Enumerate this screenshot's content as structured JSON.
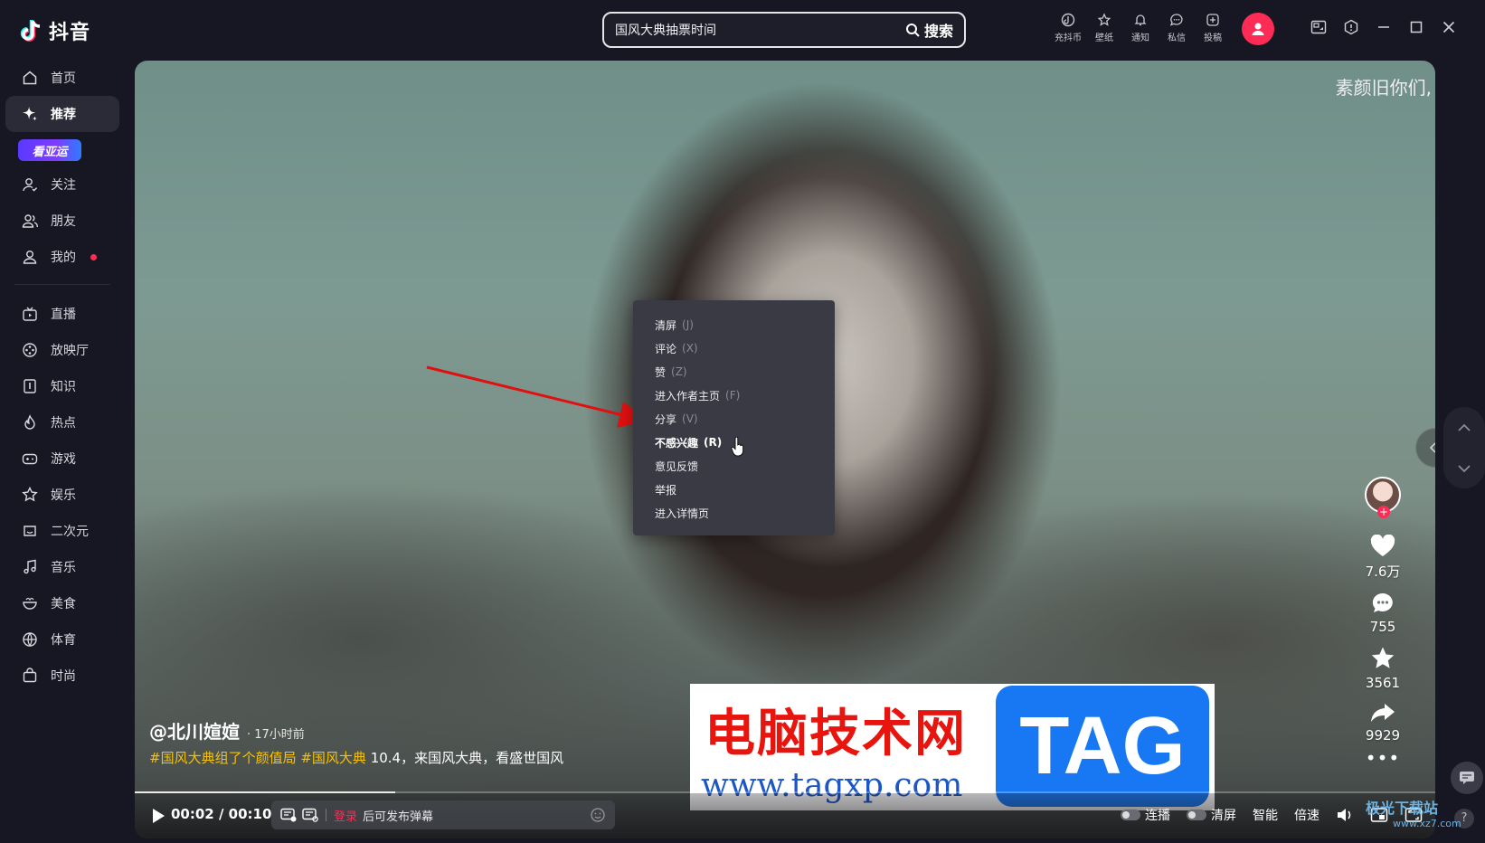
{
  "app": {
    "name": "抖音"
  },
  "search": {
    "query": "国风大典抽票时间",
    "button_label": "搜索"
  },
  "top_actions": [
    {
      "label": "充抖币",
      "icon": "coin-icon"
    },
    {
      "label": "壁纸",
      "icon": "wallpaper-icon"
    },
    {
      "label": "通知",
      "icon": "bell-icon"
    },
    {
      "label": "私信",
      "icon": "message-icon"
    },
    {
      "label": "投稿",
      "icon": "upload-icon"
    }
  ],
  "sidebar": {
    "items": [
      {
        "label": "首页",
        "icon": "home-icon"
      },
      {
        "label": "推荐",
        "icon": "sparkle-icon",
        "active": true
      },
      {
        "label": "关注",
        "icon": "follow-icon"
      },
      {
        "label": "朋友",
        "icon": "friends-icon"
      },
      {
        "label": "我的",
        "icon": "user-icon",
        "badge": true
      }
    ],
    "promo_label": "看亚运",
    "categories": [
      {
        "label": "直播",
        "icon": "tv-icon"
      },
      {
        "label": "放映厅",
        "icon": "film-icon"
      },
      {
        "label": "知识",
        "icon": "book-icon"
      },
      {
        "label": "热点",
        "icon": "flame-icon"
      },
      {
        "label": "游戏",
        "icon": "gamepad-icon"
      },
      {
        "label": "娱乐",
        "icon": "star-icon"
      },
      {
        "label": "二次元",
        "icon": "anime-icon"
      },
      {
        "label": "音乐",
        "icon": "music-icon"
      },
      {
        "label": "美食",
        "icon": "food-icon"
      },
      {
        "label": "体育",
        "icon": "ball-icon"
      },
      {
        "label": "时尚",
        "icon": "bag-icon"
      }
    ]
  },
  "video": {
    "overlay_text": "素颜旧你们,",
    "author": "@北川媗媗",
    "post_time": "· 17小时前",
    "tags": [
      "#国风大典组了个颜值局",
      "#国风大典"
    ],
    "description": " 10.4，来国风大典，看盛世国风",
    "likes": "7.6万",
    "comments": "755",
    "favorites": "3561",
    "shares": "9929",
    "progress": 0.2,
    "time": "00:02 / 00:10"
  },
  "context_menu": [
    {
      "label": "清屏",
      "key": "(J)"
    },
    {
      "label": "评论",
      "key": "(X)"
    },
    {
      "label": "赞",
      "key": "(Z)"
    },
    {
      "label": "进入作者主页",
      "key": "(F)"
    },
    {
      "label": "分享",
      "key": "(V)"
    },
    {
      "label": "不感兴趣",
      "key": "(R)",
      "highlight": true
    },
    {
      "label": "意见反馈",
      "key": ""
    },
    {
      "label": "举报",
      "key": ""
    },
    {
      "label": "进入详情页",
      "key": ""
    }
  ],
  "danmu": {
    "login_label": "登录",
    "hint": "后可发布弹幕"
  },
  "player_controls": {
    "autoplay_label": "连播",
    "clear_label": "清屏",
    "smart_label": "智能",
    "speed_label": "倍速"
  },
  "watermark": {
    "cn": "电脑技术网",
    "url": "www.tagxp.com",
    "tag": "TAG"
  },
  "corner_watermark": {
    "title": "极光下载站",
    "url": "www.xz7.com"
  },
  "colors": {
    "accent": "#fe2c55",
    "tag": "#f9c200",
    "background": "#161722"
  }
}
